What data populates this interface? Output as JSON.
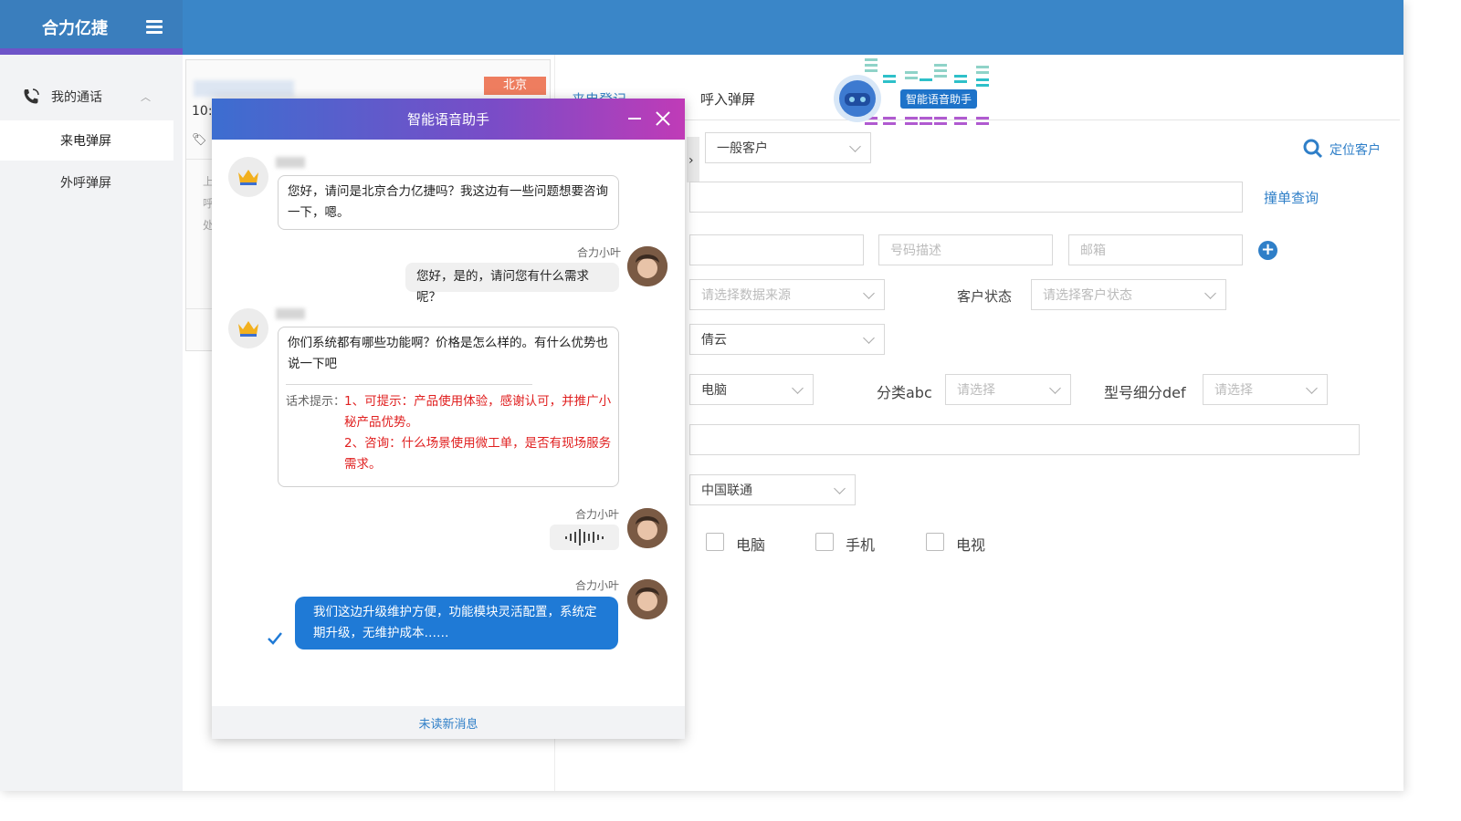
{
  "app": {
    "brand": "合力亿捷"
  },
  "sidebar": {
    "group_label": "我的通话",
    "items": [
      {
        "label": "来电弹屏",
        "active": true
      },
      {
        "label": "外呼弹屏",
        "active": false
      }
    ]
  },
  "call_card": {
    "time": "10:",
    "region_badge": "北京",
    "fragments": [
      "上",
      "呼",
      "处"
    ]
  },
  "tabs": [
    {
      "label": "来电登记",
      "active": true
    },
    {
      "label": "呼入弹屏",
      "active": false
    }
  ],
  "assistant_badge": "智能语音助手",
  "form": {
    "customer_type": "一般客户",
    "locate_customer": "定位客户",
    "order_query": "撞单查询",
    "phone_desc_placeholder": "号码描述",
    "email_placeholder": "邮箱",
    "data_source_placeholder": "请选择数据来源",
    "customer_status_label": "客户状态",
    "customer_status_placeholder": "请选择客户状态",
    "company": "倩云",
    "category": "电脑",
    "category_abc_label": "分类abc",
    "category_abc_placeholder": "请选择",
    "model_def_label": "型号细分def",
    "model_def_placeholder": "请选择",
    "carrier": "中国联通",
    "checkboxes": [
      "电脑",
      "手机",
      "电视"
    ]
  },
  "chat": {
    "title": "智能语音助手",
    "agent_name": "合力小叶",
    "messages": [
      {
        "from": "customer",
        "text": "您好，请问是北京合力亿捷吗？我这边有一些问题想要咨询一下，嗯。"
      },
      {
        "from": "agent",
        "text": "您好，是的，请问您有什么需求呢？"
      },
      {
        "from": "customer",
        "text": "你们系统都有哪些功能啊？价格是怎么样的。有什么优势也说一下吧"
      },
      {
        "from": "agent",
        "text": "[voice]"
      },
      {
        "from": "agent",
        "text": "我们这边升级维护方便，功能模块灵活配置，系统定期升级，无维护成本……"
      }
    ],
    "hint_label": "话术提示：",
    "hint_1": "1、可提示：产品使用体验，感谢认可，并推广小秘产品优势。",
    "hint_2": "2、咨询：什么场景使用微工单，是否有现场服务需求。",
    "footer": "未读新消息"
  },
  "colors": {
    "topbar": "#3a86c8",
    "accent": "#2f7fc8",
    "hint_red": "#e02020",
    "badge": "#ee7d5f"
  }
}
